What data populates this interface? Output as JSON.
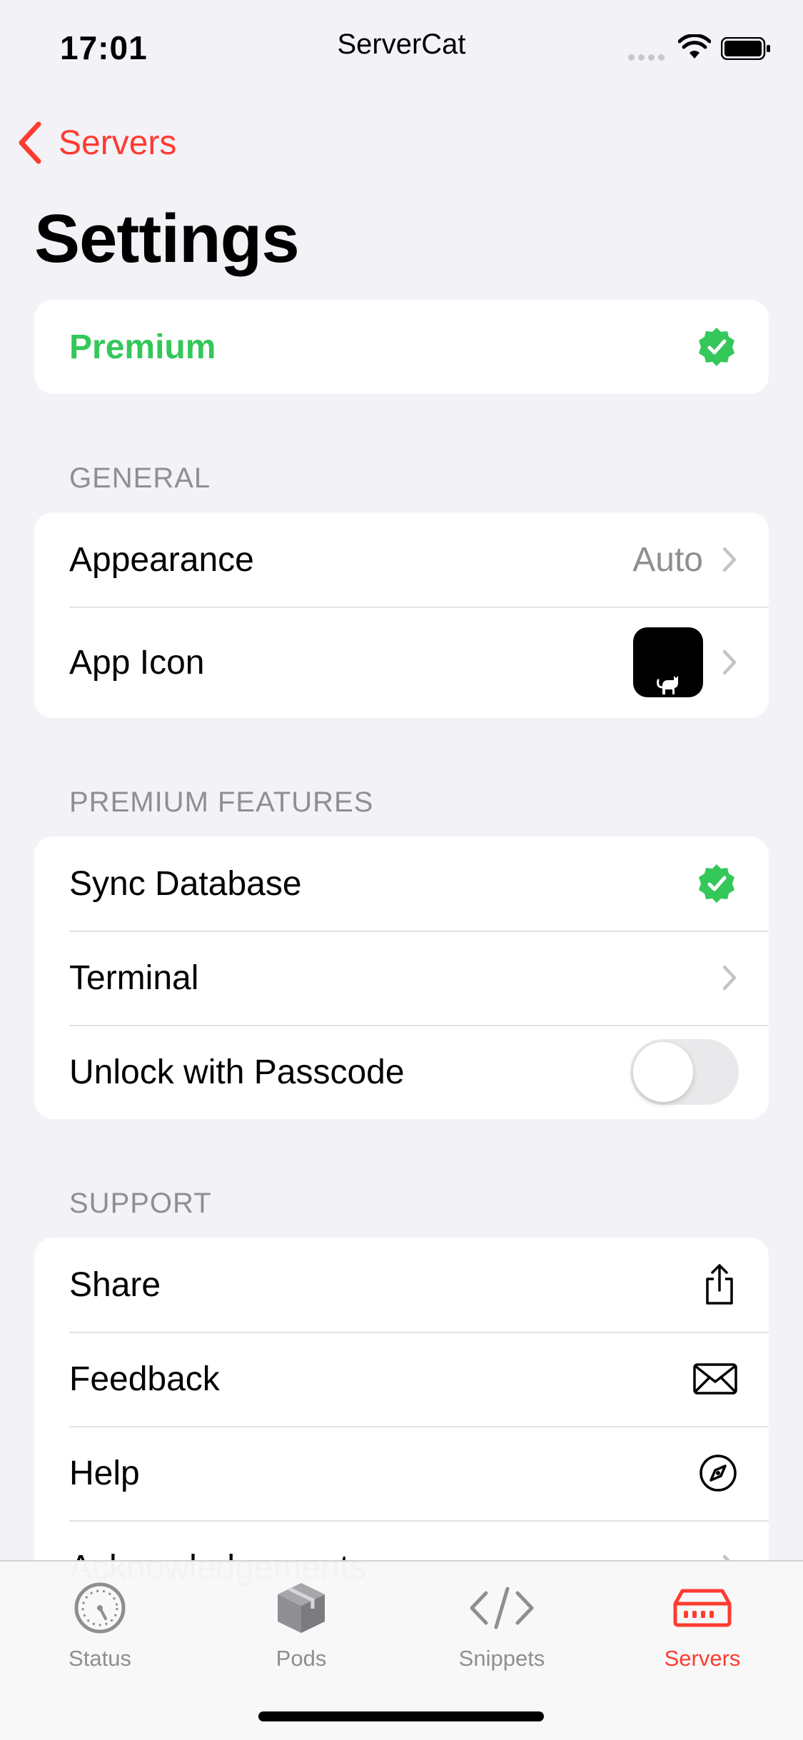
{
  "status_bar": {
    "time": "17:01",
    "carrier": "ServerCat"
  },
  "nav": {
    "back_label": "Servers",
    "title": "Settings"
  },
  "premium": {
    "label": "Premium",
    "icon": "verified-badge-icon",
    "color": "#34c759"
  },
  "sections": {
    "general": {
      "header": "GENERAL",
      "items": [
        {
          "label": "Appearance",
          "value": "Auto"
        },
        {
          "label": "App Icon"
        }
      ]
    },
    "premium_features": {
      "header": "PREMIUM FEATURES",
      "items": [
        {
          "label": "Sync Database",
          "icon": "verified-badge-icon"
        },
        {
          "label": "Terminal"
        },
        {
          "label": "Unlock with Passcode",
          "toggle_on": false
        }
      ]
    },
    "support": {
      "header": "SUPPORT",
      "items": [
        {
          "label": "Share",
          "icon": "share-icon"
        },
        {
          "label": "Feedback",
          "icon": "envelope-icon"
        },
        {
          "label": "Help",
          "icon": "compass-icon"
        },
        {
          "label": "Acknowledgements"
        }
      ]
    }
  },
  "tabbar": {
    "tabs": [
      {
        "label": "Status",
        "icon": "gauge-icon"
      },
      {
        "label": "Pods",
        "icon": "cube-icon"
      },
      {
        "label": "Snippets",
        "icon": "code-icon"
      },
      {
        "label": "Servers",
        "icon": "server-icon",
        "active": true
      }
    ]
  },
  "colors": {
    "accent": "#ff3b30",
    "success": "#34c759",
    "secondary": "#8e8e93",
    "background": "#f2f2f7"
  }
}
